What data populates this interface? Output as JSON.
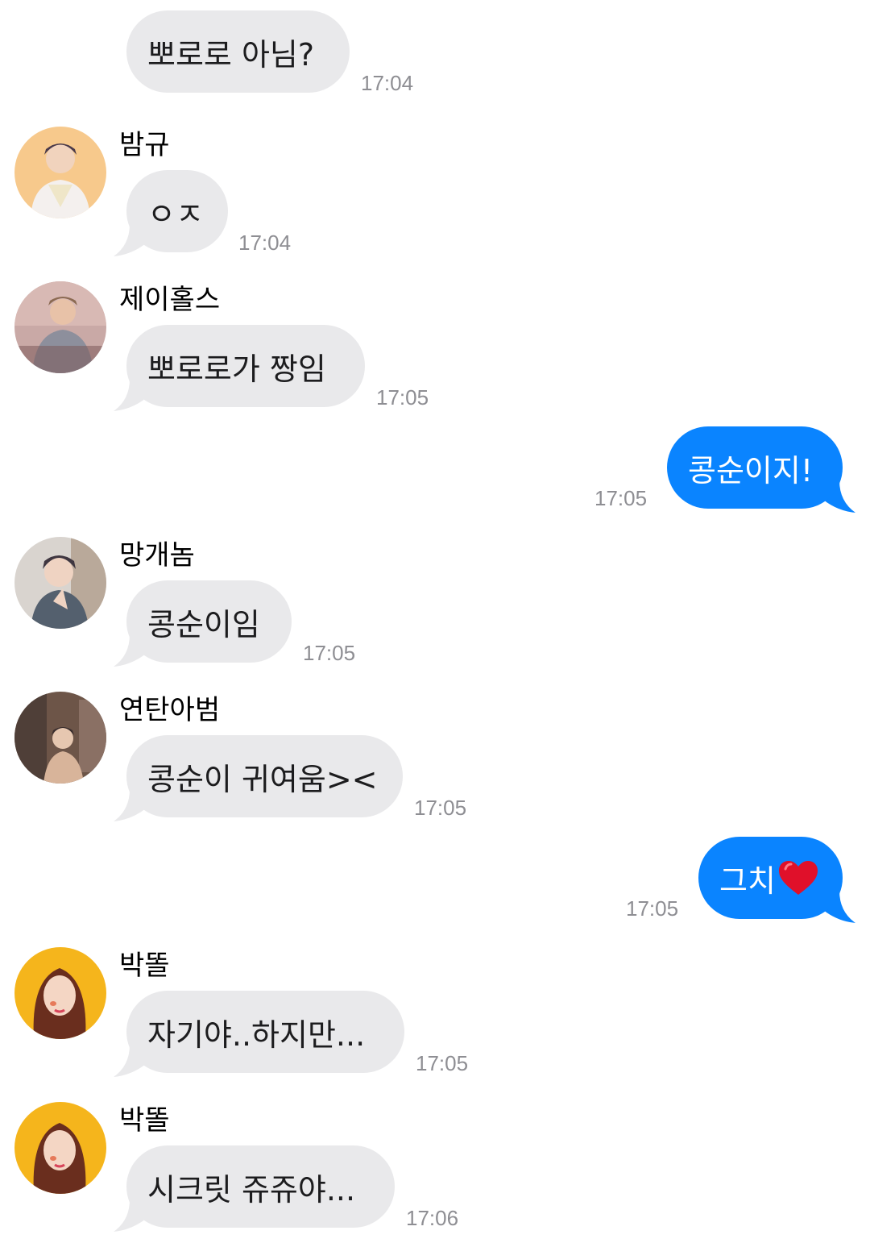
{
  "colors": {
    "incoming_bubble": "#e9e9eb",
    "outgoing_bubble": "#0a84ff",
    "timestamp": "#8e8e93",
    "background": "#ffffff"
  },
  "messages": [
    {
      "direction": "incoming",
      "sender": "",
      "text": "뽀로로 아님?",
      "time": "17:04"
    },
    {
      "direction": "incoming",
      "sender": "밤규",
      "avatar": "avatar-bamgyu",
      "text": "ㅇㅈ",
      "time": "17:04"
    },
    {
      "direction": "incoming",
      "sender": "제이홀스",
      "avatar": "avatar-jhorse",
      "text": "뽀로로가 짱임",
      "time": "17:05"
    },
    {
      "direction": "outgoing",
      "text": "콩순이지!",
      "time": "17:05"
    },
    {
      "direction": "incoming",
      "sender": "망개놈",
      "avatar": "avatar-manggae",
      "text": "콩순이임",
      "time": "17:05"
    },
    {
      "direction": "incoming",
      "sender": "연탄아범",
      "avatar": "avatar-yeontan",
      "text": "콩순이 귀여움><",
      "time": "17:05"
    },
    {
      "direction": "outgoing",
      "text": "그치",
      "emoji": "heart-emoji",
      "time": "17:05"
    },
    {
      "direction": "incoming",
      "sender": "박똘",
      "avatar": "avatar-parkttol",
      "text": "자기야..하지만...",
      "time": "17:05"
    },
    {
      "direction": "incoming",
      "sender": "박똘",
      "avatar": "avatar-parkttol",
      "text": "시크릿 쥬쥬야...",
      "time": "17:06"
    }
  ]
}
